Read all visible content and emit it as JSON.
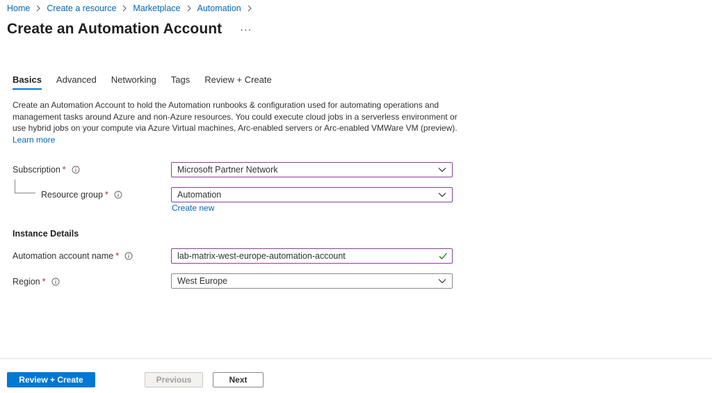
{
  "breadcrumb": {
    "items": [
      "Home",
      "Create a resource",
      "Marketplace",
      "Automation"
    ]
  },
  "page": {
    "title": "Create an Automation Account",
    "more": "···"
  },
  "tabs": [
    "Basics",
    "Advanced",
    "Networking",
    "Tags",
    "Review + Create"
  ],
  "active_tab": "Basics",
  "intro": {
    "text": "Create an Automation Account to hold the Automation runbooks & configuration used for automating operations and management tasks around Azure and non-Azure resources. You could execute cloud jobs in a serverless environment or use hybrid jobs on your compute via Azure Virtual machines, Arc-enabled servers or Arc-enabled VMWare VM (preview).",
    "learn_more": "Learn more"
  },
  "form": {
    "subscription": {
      "label": "Subscription",
      "required": "*",
      "value": "Microsoft Partner Network"
    },
    "resource_group": {
      "label": "Resource group",
      "required": "*",
      "value": "Automation",
      "create_new": "Create new"
    },
    "instance_details": "Instance Details",
    "account_name": {
      "label": "Automation account name",
      "required": "*",
      "value": "lab-matrix-west-europe-automation-account"
    },
    "region": {
      "label": "Region",
      "required": "*",
      "value": "West Europe"
    }
  },
  "footer": {
    "review_create": "Review + Create",
    "previous": "Previous",
    "next": "Next"
  },
  "colors": {
    "accent": "#0078d4",
    "link": "#0067b8",
    "required": "#a4262c",
    "focused_border": "#8a3c9c",
    "valid_check": "#107c10"
  },
  "icons": {
    "breadcrumb_separator": "chevron-right-icon",
    "info": "info-icon",
    "dropdown": "chevron-down-icon",
    "valid": "checkmark-icon"
  }
}
